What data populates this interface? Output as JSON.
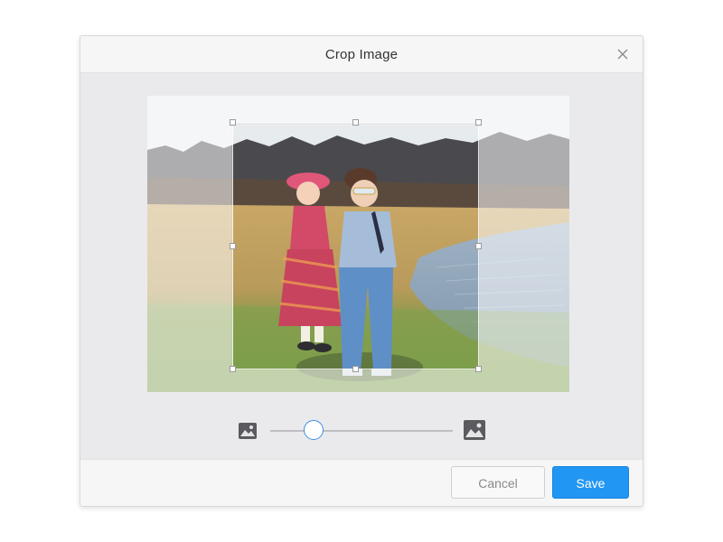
{
  "dialog": {
    "title": "Crop Image",
    "close_icon": "close-icon"
  },
  "image": {
    "alt": "Two children standing by a pond"
  },
  "zoom": {
    "min_icon": "image-small-icon",
    "max_icon": "image-large-icon",
    "level": 0.24
  },
  "footer": {
    "cancel_label": "Cancel",
    "save_label": "Save"
  },
  "colors": {
    "accent": "#2196f3",
    "slider_thumb_border": "#3c8ee0"
  }
}
